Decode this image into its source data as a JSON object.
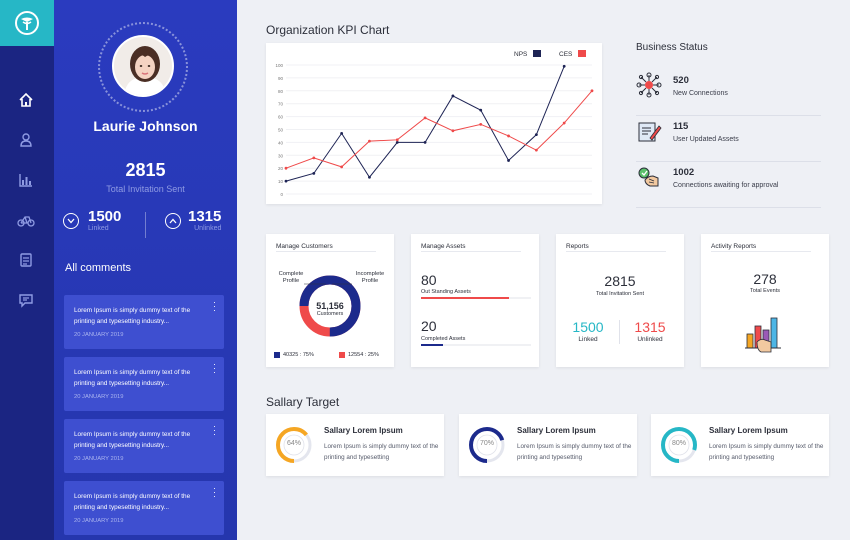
{
  "sidebar_nav": {
    "items": [
      {
        "icon": "home-icon",
        "active": true
      },
      {
        "icon": "user-icon"
      },
      {
        "icon": "bar-chart-icon"
      },
      {
        "icon": "bicycle-icon"
      },
      {
        "icon": "document-icon"
      },
      {
        "icon": "chat-icon"
      }
    ]
  },
  "profile": {
    "name": "Laurie Johnson",
    "invitation_count": "2815",
    "invitation_label": "Total Invitation Sent",
    "linked_count": "1500",
    "linked_label": "Linked",
    "unlinked_count": "1315",
    "unlinked_label": "Unlinked"
  },
  "comments": {
    "title": "All comments",
    "items": [
      {
        "text": "Lorem Ipsum is simply dummy text of the printing and typesetting industry...",
        "date": "20 JANUARY 2019"
      },
      {
        "text": "Lorem Ipsum is simply dummy text of the printing and typesetting industry...",
        "date": "20 JANUARY 2019"
      },
      {
        "text": "Lorem Ipsum is simply dummy text of the printing and typesetting industry...",
        "date": "20 JANUARY 2019"
      },
      {
        "text": "Lorem Ipsum is simply dummy text of the printing and typesetting industry...",
        "date": "20 JANUARY 2019"
      }
    ]
  },
  "kpi": {
    "title": "Organization KPI Chart"
  },
  "chart_data": {
    "type": "line",
    "title": "Organization KPI Chart",
    "x": [
      1,
      2,
      3,
      4,
      5,
      6,
      7,
      8,
      9,
      10,
      11,
      12
    ],
    "ylim": [
      0,
      100
    ],
    "yticks": [
      "0",
      "10",
      "20",
      "30",
      "40",
      "50",
      "60",
      "70",
      "80",
      "90",
      "100"
    ],
    "legend_position": "top-right",
    "grid": true,
    "series": [
      {
        "name": "NPS",
        "color": "#1e2455",
        "values": [
          10,
          16,
          47,
          13,
          40,
          40,
          76,
          65,
          26,
          46,
          99
        ]
      },
      {
        "name": "CES",
        "color": "#ef4a4a",
        "values": [
          20,
          28,
          21,
          41,
          42,
          59,
          49,
          54,
          45,
          34,
          55,
          80
        ]
      }
    ]
  },
  "business_status": {
    "title": "Business Status",
    "items": [
      {
        "value": "520",
        "label": "New Connections",
        "icon": "network-icon"
      },
      {
        "value": "115",
        "label": "User Updated Assets",
        "icon": "edit-document-icon"
      },
      {
        "value": "1002",
        "label": "Connections awaiting for approval",
        "icon": "handshake-icon"
      }
    ]
  },
  "manage_customers": {
    "title": "Manage Customers",
    "total": "51,156",
    "total_label": "Customers",
    "complete_label": "Complete Profile",
    "incomplete_label": "Incomplete Profile",
    "legend_complete": "40325 : 75%",
    "legend_incomplete": "12554 : 25%",
    "complete_fraction": 0.75,
    "complete_color": "#1c2a8c",
    "incomplete_color": "#ef4a4a"
  },
  "manage_assets": {
    "title": "Manage Assets",
    "outstanding_value": "80",
    "outstanding_label": "Out Standing Assets",
    "completed_value": "20",
    "completed_label": "Completed Assets"
  },
  "reports": {
    "title": "Reports",
    "total": "2815",
    "total_label": "Total Invitation Sent",
    "linked": "1500",
    "linked_label": "Linked",
    "unlinked": "1315",
    "unlinked_label": "Unlinked",
    "linked_color": "#26b7c6",
    "unlinked_color": "#ef4a4a"
  },
  "activity_reports": {
    "title": "Activity Reports",
    "total": "278",
    "total_label": "Total Events"
  },
  "salary": {
    "title": "Sallary Target",
    "cards": [
      {
        "title": "Sallary Lorem Ipsum",
        "text": "Lorem Ipsum is simply dummy text of the printing and typesetting",
        "percent_label": "64%",
        "percent": 0.64,
        "color": "#f5a623"
      },
      {
        "title": "Sallary Lorem Ipsum",
        "text": "Lorem Ipsum is simply dummy text of the printing and typesetting",
        "percent_label": "70%",
        "percent": 0.7,
        "color": "#1c2a8c"
      },
      {
        "title": "Sallary Lorem Ipsum",
        "text": "Lorem Ipsum is simply dummy text of the printing and typesetting",
        "percent_label": "80%",
        "percent": 0.8,
        "color": "#26b7c6"
      }
    ]
  }
}
